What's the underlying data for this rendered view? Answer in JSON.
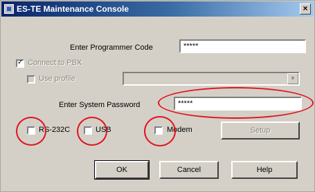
{
  "window": {
    "title": "ES-TE Maintenance Console",
    "close_glyph": "×"
  },
  "programmer_code": {
    "label": "Enter Programmer Code",
    "value": "*****"
  },
  "connect_pbx": {
    "label": "Connect to PBX",
    "checked": true
  },
  "use_profile": {
    "label": "Use profile",
    "value": ""
  },
  "system_password": {
    "label": "Enter System Password",
    "value": "*****"
  },
  "connection": {
    "rs232c_label": "RS-232C",
    "usb_label": "USB",
    "modem_label": "Modem",
    "setup_button": "Setup"
  },
  "buttons": {
    "ok": "OK",
    "cancel": "Cancel",
    "help": "Help"
  },
  "annotation_color": "#e0141e"
}
